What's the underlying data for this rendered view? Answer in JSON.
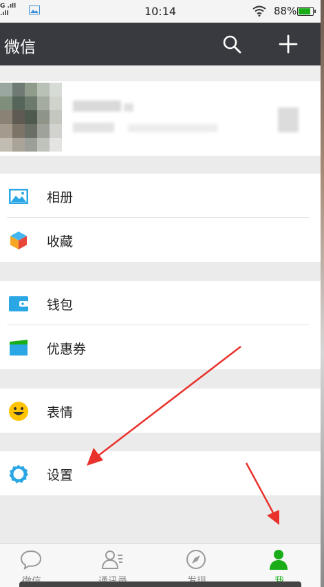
{
  "status": {
    "signal": "G .ıll",
    "time": "10:14",
    "battery": "88%"
  },
  "header": {
    "title": "微信"
  },
  "menu": {
    "album": "相册",
    "favorites": "收藏",
    "wallet": "钱包",
    "coupons": "优惠券",
    "stickers": "表情",
    "settings": "设置"
  },
  "tabs": [
    {
      "label": "微信"
    },
    {
      "label": "通讯录"
    },
    {
      "label": "发现"
    },
    {
      "label": "我"
    }
  ],
  "colors": {
    "accent": "#1aad19",
    "header": "#393a3f",
    "arrow": "#e8322b"
  }
}
